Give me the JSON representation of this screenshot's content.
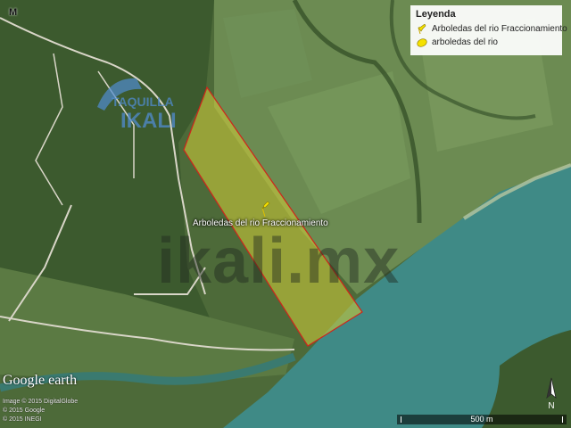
{
  "legend": {
    "title": "Leyenda",
    "items": [
      {
        "label": "Arboledas del rio Fraccionamiento",
        "icon": "yellow-pushpin-icon",
        "color": "#f5e100"
      },
      {
        "label": "arboledas del rio",
        "icon": "yellow-polygon-icon",
        "color": "#f5e100"
      }
    ]
  },
  "corner_mark": "M",
  "placemark": {
    "label": "Arboledas del rio Fraccionamiento",
    "icon": "yellow-pushpin-icon",
    "color": "#f5e100"
  },
  "polygon": {
    "fill": "#c9c83a",
    "stroke": "#d0241b"
  },
  "watermark": "ikali.mx",
  "logo": {
    "line1": "TAQUILLA",
    "line2": "IKALI",
    "color": "#4f8fd6"
  },
  "google_earth": "Google earth",
  "credits": [
    "Image © 2015 DigitalGlobe",
    "© 2015 Google",
    "© 2015 INEGI"
  ],
  "scale": {
    "label": "500 m"
  },
  "compass": {
    "label": "N"
  },
  "colors": {
    "river": "#3f8a86",
    "fields": "#6f8a55",
    "forest": "#3e5a2f"
  }
}
